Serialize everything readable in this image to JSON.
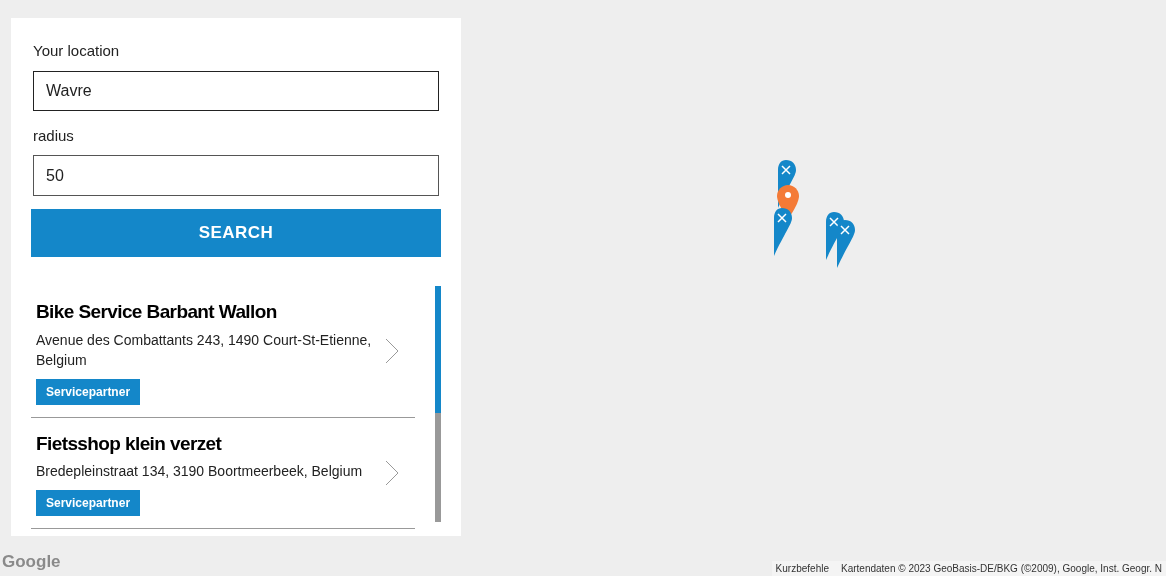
{
  "search_panel": {
    "location": {
      "label": "Your location",
      "value": "Wavre"
    },
    "radius": {
      "label": "radius",
      "value": "50"
    },
    "search_button": "SEARCH"
  },
  "results": [
    {
      "name": "Bike Service Barbant Wallon",
      "address": "Avenue des Combattants 243, 1490 Court-St-Etienne, Belgium",
      "tag": "Servicepartner"
    },
    {
      "name": "Fietsshop klein verzet",
      "address": "Bredepleinstraat 134, 3190 Boortmeerbeek, Belgium",
      "tag": "Servicepartner"
    }
  ],
  "map": {
    "markers": [
      {
        "kind": "service"
      },
      {
        "kind": "location"
      },
      {
        "kind": "service"
      },
      {
        "kind": "service"
      },
      {
        "kind": "service"
      }
    ],
    "logo": "Google",
    "shortcuts": "Kurzbefehle",
    "attribution": "Kartendaten © 2023 GeoBasis-DE/BKG (©2009), Google, Inst. Geogr. N"
  }
}
